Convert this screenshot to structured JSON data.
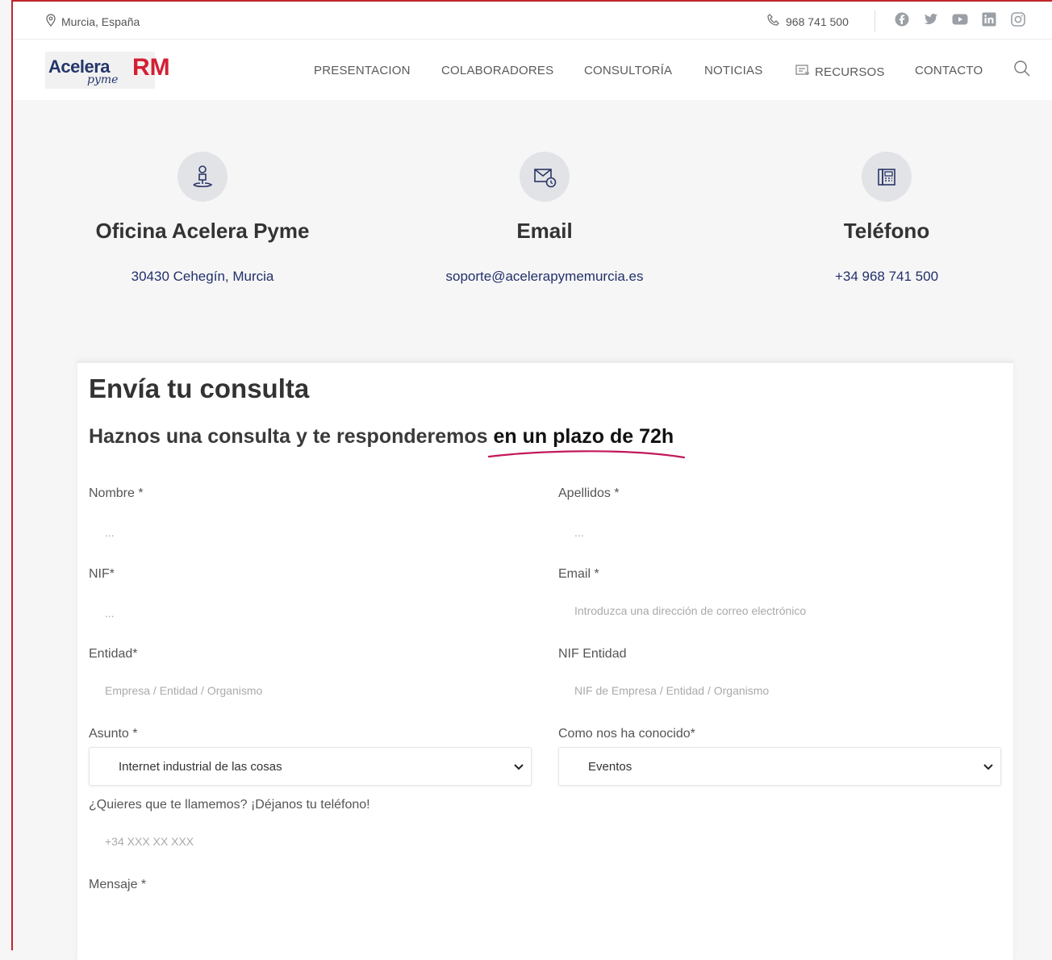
{
  "topbar": {
    "location": "Murcia, España",
    "phone": "968 741 500",
    "social": [
      "facebook-icon",
      "twitter-icon",
      "youtube-icon",
      "linkedin-icon",
      "instagram-icon"
    ]
  },
  "header": {
    "logo": {
      "word": "Acelera",
      "sub": "pyme",
      "brand": "RM"
    },
    "nav": [
      {
        "label": "PRESENTACION"
      },
      {
        "label": "COLABORADORES"
      },
      {
        "label": "CONSULTORÍA"
      },
      {
        "label": "NOTICIAS"
      },
      {
        "label": "RECURSOS"
      },
      {
        "label": "CONTACTO"
      }
    ]
  },
  "info": [
    {
      "icon": "location-pin-icon",
      "title": "Oficina Acelera Pyme",
      "text": "30430 Cehegín, Murcia"
    },
    {
      "icon": "email-icon",
      "title": "Email",
      "text": "soporte@acelerapymemurcia.es"
    },
    {
      "icon": "phone-icon",
      "title": "Teléfono",
      "text": "+34 968 741 500"
    }
  ],
  "form": {
    "title": "Envía tu consulta",
    "subtitle_pre": "Haznos una consulta y te responderemos ",
    "subtitle_hl": "en un plazo de 72h",
    "fields": {
      "nombre": {
        "label": "Nombre *",
        "placeholder": "..."
      },
      "apellidos": {
        "label": "Apellidos *",
        "placeholder": "..."
      },
      "nif": {
        "label": "NIF*",
        "placeholder": "..."
      },
      "email": {
        "label": "Email *",
        "placeholder": "Introduzca una dirección de correo electrónico"
      },
      "entidad": {
        "label": "Entidad*",
        "placeholder": "Empresa / Entidad / Organismo"
      },
      "nif_entidad": {
        "label": "NIF Entidad",
        "placeholder": "NIF de Empresa / Entidad / Organismo"
      },
      "asunto": {
        "label": "Asunto *",
        "value": "Internet industrial de las cosas"
      },
      "conocido": {
        "label": "Como nos ha conocido*",
        "value": "Eventos"
      },
      "telefono": {
        "label": "¿Quieres que te llamemos? ¡Déjanos tu teléfono!",
        "placeholder": "+34 XXX XX XXX"
      },
      "mensaje": {
        "label": "Mensaje *"
      }
    }
  },
  "colors": {
    "brand_blue": "#24366b",
    "brand_red": "#d41e34",
    "accent_underline": "#c2185b"
  }
}
